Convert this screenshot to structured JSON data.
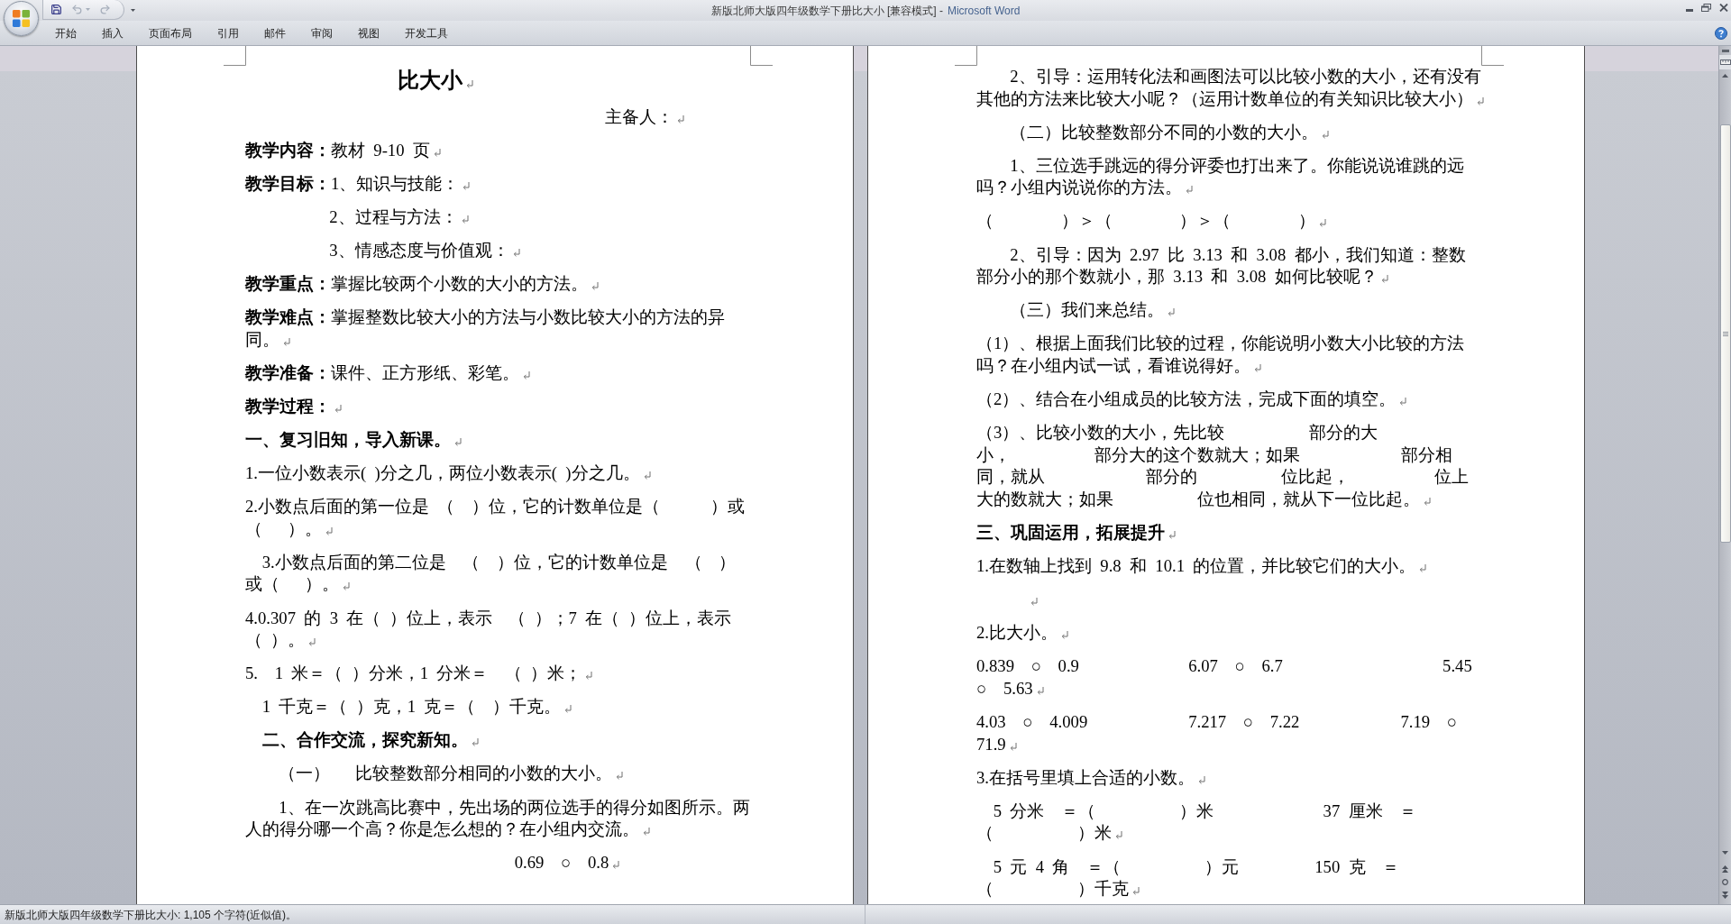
{
  "window": {
    "document_title": "新版北师大版四年级数学下册比大小 [兼容模式] -",
    "app_name": "Microsoft Word"
  },
  "quick_access": [
    {
      "kind": "save",
      "disabled": false
    },
    {
      "kind": "undo",
      "disabled": true
    },
    {
      "kind": "redo",
      "disabled": true
    }
  ],
  "ribbon_tabs": [
    {
      "label": "开始",
      "selected": false
    },
    {
      "label": "插入",
      "selected": false
    },
    {
      "label": "页面布局",
      "selected": false
    },
    {
      "label": "引用",
      "selected": false
    },
    {
      "label": "邮件",
      "selected": false
    },
    {
      "label": "审阅",
      "selected": false
    },
    {
      "label": "视图",
      "selected": false
    },
    {
      "label": "开发工具",
      "selected": false
    }
  ],
  "document": {
    "formatting_marks": true,
    "pages": [
      {
        "paragraphs": [
          {
            "kind": "title",
            "text": "比大小"
          },
          {
            "kind": "signer",
            "text": "主备人："
          },
          {
            "kind": "text",
            "text": "**教学内容：**教材 9-10 页"
          },
          {
            "kind": "text",
            "text": "**教学目标：**1、知识与技能："
          },
          {
            "kind": "continuation",
            "text": "2、过程与方法："
          },
          {
            "kind": "continuation",
            "text": "3、情感态度与价值观："
          },
          {
            "kind": "text",
            "text": "**教学重点：**掌握比较两个小数的大小的方法。"
          },
          {
            "kind": "text",
            "text": "**教学难点：**掌握整数比较大小的方法与小数比较大小的方法的异同。"
          },
          {
            "kind": "text",
            "text": "**教学准备：**课件、正方形纸、彩笔。"
          },
          {
            "kind": "heading",
            "text": "教学过程："
          },
          {
            "kind": "heading",
            "text": "一、复习旧知，导入新课。"
          },
          {
            "kind": "text",
            "text": "1.一位小数表示( )分之几，两位小数表示( )分之几。"
          },
          {
            "kind": "text",
            "text": "2.小数点后面的第一位是 （  ）位，它的计数单位是（      ）或（   ）。"
          },
          {
            "kind": "text_offset",
            "text": "3.小数点后面的第二位是  （  ）位，它的计数单位是  （  ）或（   ）。"
          },
          {
            "kind": "text",
            "text": "4.0.307 的 3 在（ ）位上，表示  （ ）；7 在（ ）位上，表示（ ）。"
          },
          {
            "kind": "text",
            "text": "5.  1 米＝（ ）分米，1 分米＝  （ ）米；"
          },
          {
            "kind": "text_offset",
            "text": "1 千克＝（ ）克，1 克＝（  ）千克。"
          },
          {
            "kind": "heading_offset",
            "text": "二、合作交流，探究新知。"
          },
          {
            "kind": "first_line_indent",
            "text": "（一）   比较整数部分相同的小数的大小。"
          },
          {
            "kind": "first_line_indent",
            "text": "1、在一次跳高比赛中，先出场的两位选手的得分如图所示。两人的得分哪一个高？你是怎么想的？在小组内交流。"
          },
          {
            "kind": "figure",
            "text": "0.69  ○  0.8"
          }
        ]
      },
      {
        "paragraphs": [
          {
            "kind": "first_line_indent",
            "text": "2、引导：运用转化法和画图法可以比较小数的大小，还有没有其他的方法来比较大小呢？（运用计数单位的有关知识比较大小）"
          },
          {
            "kind": "first_line_indent",
            "text": "（二）比较整数部分不同的小数的大小。"
          },
          {
            "kind": "first_line_indent",
            "text": "1、三位选手跳远的得分评委也打出来了。你能说说谁跳的远吗？小组内说说你的方法。"
          },
          {
            "kind": "text",
            "text": "（        ）＞（        ）＞（        ）"
          },
          {
            "kind": "first_line_indent",
            "text": "2、引导：因为 2.97 比 3.13 和 3.08 都小，我们知道：整数部分小的那个数就小，那 3.13 和 3.08 如何比较呢？"
          },
          {
            "kind": "first_line_indent",
            "text": "（三）我们来总结。"
          },
          {
            "kind": "text",
            "text": "（1）、根据上面我们比较的过程，你能说明小数大小比较的方法吗？在小组内试一试，看谁说得好。"
          },
          {
            "kind": "text",
            "text": "（2）、结合在小组成员的比较方法，完成下面的填空。"
          },
          {
            "kind": "text",
            "text": "（3）、比较小数的大小，先比较          部分的大小，          部分大的这个数就大；如果            部分相同，就从            部分的          位比起，          位上大的数就大；如果          位也相同，就从下一位比起。"
          },
          {
            "kind": "heading",
            "text": "三、巩固运用，拓展提升"
          },
          {
            "kind": "text",
            "text": "1.在数轴上找到 9.8 和 10.1 的位置，并比较它们的大小。"
          },
          {
            "kind": "blank"
          },
          {
            "kind": "text",
            "text": "2.比大小。"
          },
          {
            "kind": "text",
            "text": "0.839  ○  0.9             6.07  ○  6.7                   5.45 ○  5.63"
          },
          {
            "kind": "text",
            "text": "4.03  ○  4.009            7.217  ○  7.22            7.19  ○  71.9"
          },
          {
            "kind": "text",
            "text": "3.在括号里填上合适的小数。"
          },
          {
            "kind": "text_offset",
            "text": "5 分米  ＝（          ）米             37 厘米  ＝（          ）米"
          },
          {
            "kind": "text_offset",
            "text": "5 元 4 角  ＝（          ）元         150 克  ＝（          ）千克"
          }
        ]
      }
    ]
  },
  "status_bar": {
    "text": "新版北师大版四年级数学下册比大小: 1,105 个字符(近似值)。"
  }
}
